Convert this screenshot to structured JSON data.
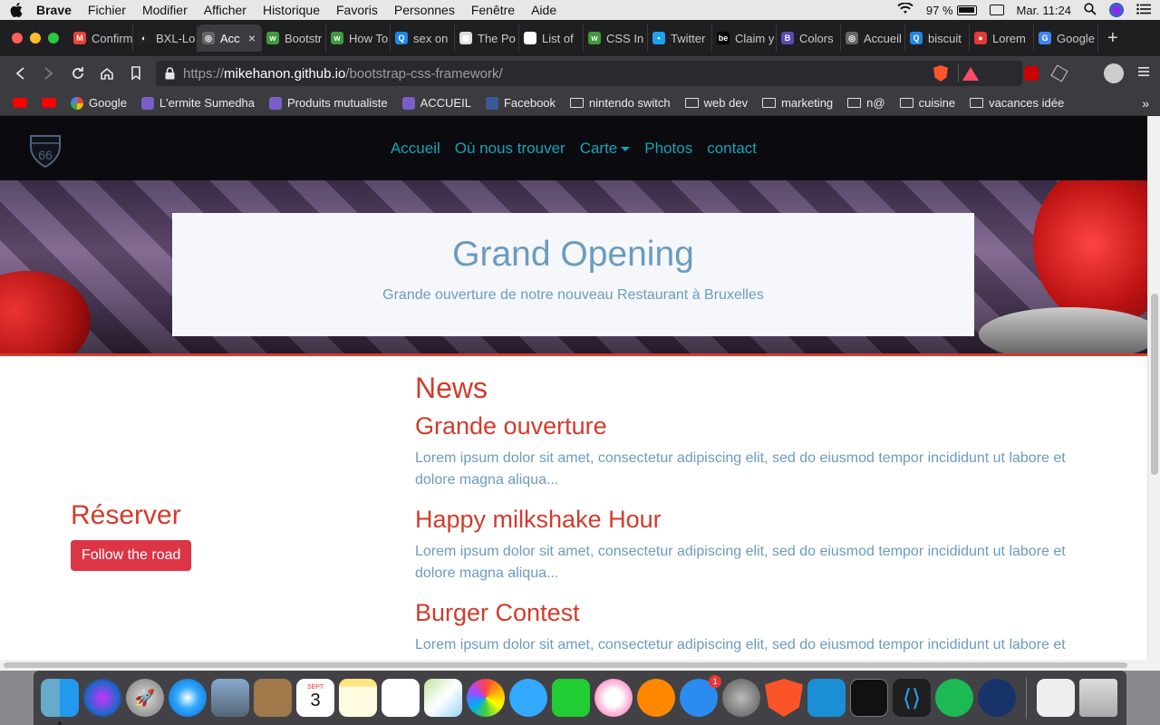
{
  "menubar": {
    "app": "Brave",
    "items": [
      "Fichier",
      "Modifier",
      "Afficher",
      "Historique",
      "Favoris",
      "Personnes",
      "Fenêtre",
      "Aide"
    ],
    "battery": "97 %",
    "clock": "Mar. 11:24"
  },
  "tabs": [
    {
      "label": "Confirm",
      "color": "#ea4335",
      "glyph": "M"
    },
    {
      "label": "BXL-Lo",
      "color": "#222",
      "glyph": "◐"
    },
    {
      "label": "Acc",
      "color": "#666",
      "glyph": "◎",
      "active": true
    },
    {
      "label": "Bootstr",
      "color": "#3f9a3f",
      "glyph": "w"
    },
    {
      "label": "How To",
      "color": "#3f9a3f",
      "glyph": "w"
    },
    {
      "label": "sex on",
      "color": "#1e88e5",
      "glyph": "Q"
    },
    {
      "label": "The Po",
      "color": "#ddd",
      "glyph": "▦"
    },
    {
      "label": "List of",
      "color": "#fff",
      "glyph": "W"
    },
    {
      "label": "CSS In",
      "color": "#3f9a3f",
      "glyph": "w"
    },
    {
      "label": "Twitter",
      "color": "#1da1f2",
      "glyph": "▪"
    },
    {
      "label": "Claim y",
      "color": "#000",
      "glyph": "be"
    },
    {
      "label": "Colors",
      "color": "#5b4bb5",
      "glyph": "B"
    },
    {
      "label": "Accueil",
      "color": "#666",
      "glyph": "◎"
    },
    {
      "label": "biscuit",
      "color": "#1e88e5",
      "glyph": "Q"
    },
    {
      "label": "Lorem",
      "color": "#e53935",
      "glyph": "●"
    },
    {
      "label": "Google",
      "color": "#4285f4",
      "glyph": "G"
    }
  ],
  "url": {
    "scheme": "https://",
    "host": "mikehanon.github.io",
    "path": "/bootstrap-css-framework/"
  },
  "bookmarks": [
    {
      "label": "",
      "type": "youtube"
    },
    {
      "label": "",
      "type": "youtube"
    },
    {
      "label": "Google",
      "type": "google"
    },
    {
      "label": "L'ermite Sumedha",
      "type": "site"
    },
    {
      "label": "Produits mutualiste",
      "type": "site"
    },
    {
      "label": "ACCUEIL",
      "type": "site"
    },
    {
      "label": "Facebook",
      "type": "facebook"
    },
    {
      "label": "nintendo switch",
      "type": "folder"
    },
    {
      "label": "web dev",
      "type": "folder"
    },
    {
      "label": "marketing",
      "type": "folder"
    },
    {
      "label": "n@",
      "type": "folder"
    },
    {
      "label": "cuisine",
      "type": "folder"
    },
    {
      "label": "vacances idée",
      "type": "folder"
    }
  ],
  "site": {
    "logo_text": "66",
    "nav": [
      "Accueil",
      "Où nous trouver",
      "Carte",
      "Photos",
      "contact"
    ],
    "hero": {
      "title": "Grand Opening",
      "subtitle": "Grande ouverture de notre nouveau Restaurant à Bruxelles"
    },
    "reserve": {
      "heading": "Réserver",
      "button": "Follow the road"
    },
    "news": {
      "heading": "News",
      "items": [
        {
          "title": "Grande ouverture",
          "body": "Lorem ipsum dolor sit amet, consectetur adipiscing elit, sed do eiusmod tempor incididunt ut labore et dolore magna aliqua..."
        },
        {
          "title": "Happy milkshake Hour",
          "body": "Lorem ipsum dolor sit amet, consectetur adipiscing elit, sed do eiusmod tempor incididunt ut labore et dolore magna aliqua..."
        },
        {
          "title": "Burger Contest",
          "body": "Lorem ipsum dolor sit amet, consectetur adipiscing elit, sed do eiusmod tempor incididunt ut labore et dolore magna aliqua..."
        }
      ]
    }
  },
  "dock": {
    "calendar_day": "3",
    "calendar_month": "SEPT",
    "appstore_badge": "1",
    "apps": [
      "finder",
      "siri",
      "launchpad",
      "safari",
      "mail",
      "notes-brown",
      "calendar",
      "notes",
      "reminders",
      "maps",
      "photos",
      "messages",
      "facetime",
      "itunes",
      "books",
      "app-store",
      "system-preferences",
      "brave",
      "affinity",
      "terminal",
      "vscode",
      "spotify",
      "steam",
      "documents",
      "trash"
    ]
  }
}
